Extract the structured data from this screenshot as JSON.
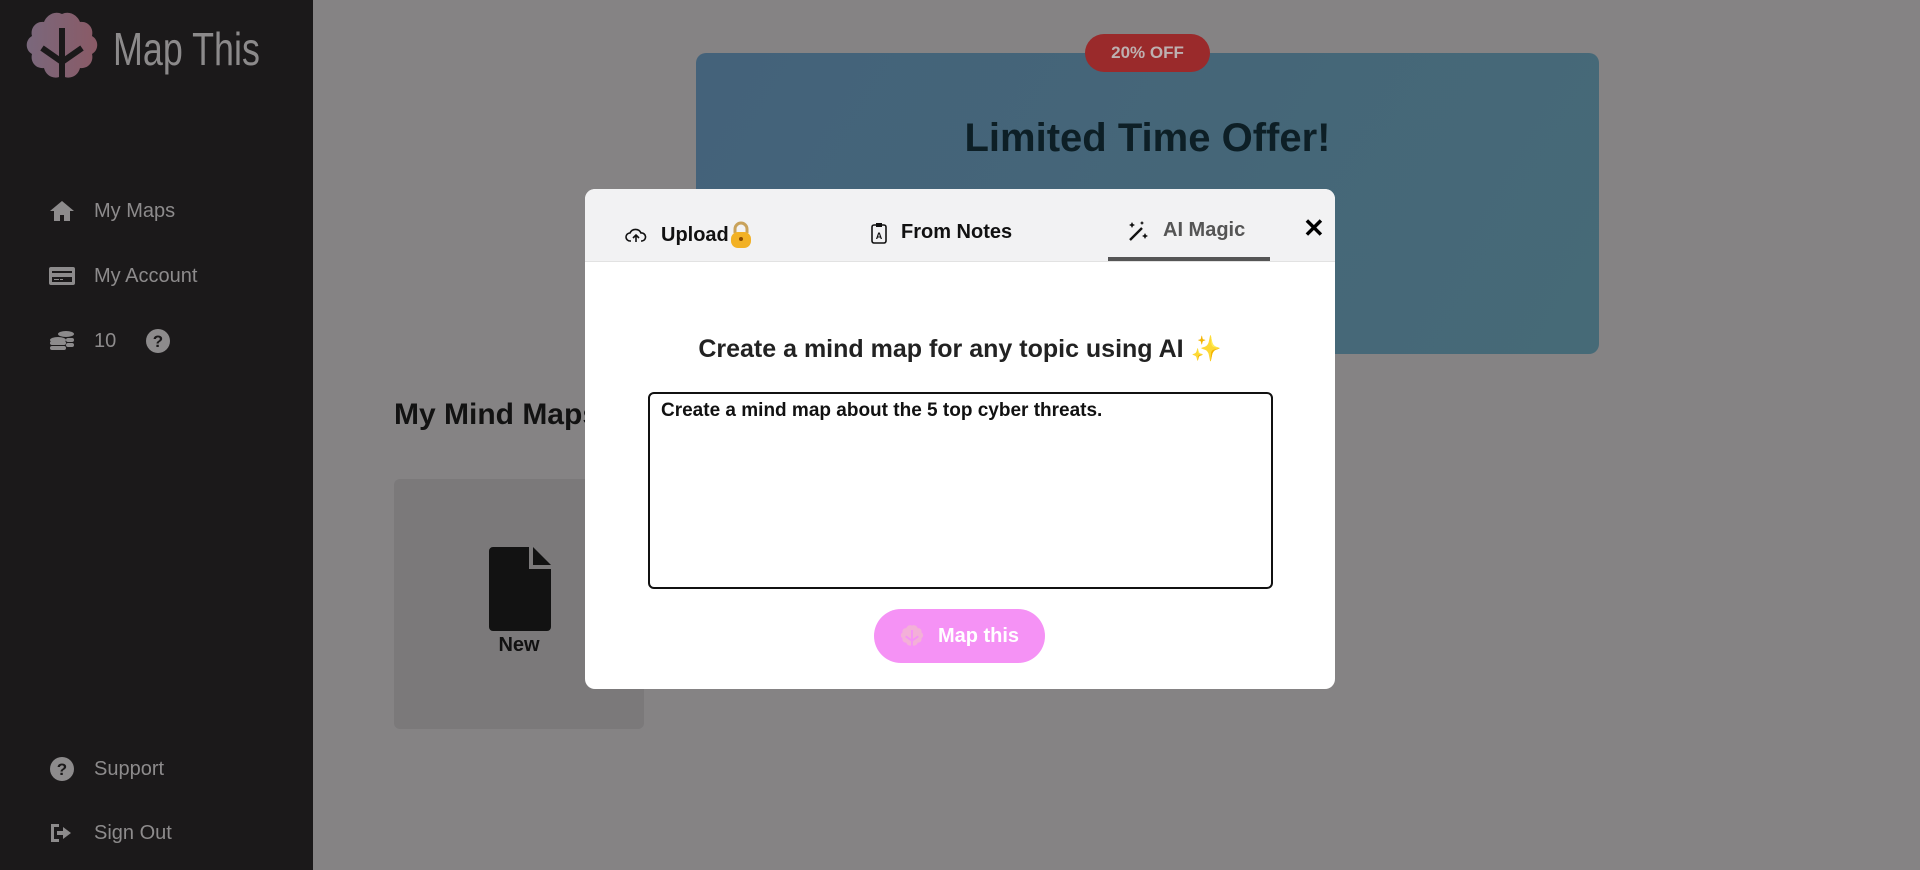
{
  "app": {
    "name": "Map This"
  },
  "sidebar": {
    "items": [
      {
        "label": "My Maps",
        "icon": "home-icon"
      },
      {
        "label": "My Account",
        "icon": "credit-card-icon"
      },
      {
        "label": "10",
        "icon": "coins-icon"
      }
    ],
    "bottom": [
      {
        "label": "Support",
        "icon": "question-circle-icon"
      },
      {
        "label": "Sign Out",
        "icon": "sign-out-icon"
      }
    ]
  },
  "banner": {
    "badge": "20% OFF",
    "title": "Limited Time Offer!"
  },
  "main": {
    "title": "My Mind Maps",
    "new_card": "New"
  },
  "modal": {
    "tabs": [
      {
        "label": "Upload",
        "locked": true
      },
      {
        "label": "From Notes"
      },
      {
        "label": "AI Magic",
        "active": true
      }
    ],
    "close": "✕",
    "heading": "Create a mind map for any topic using AI ✨",
    "input_value": "Create a mind map about the 5 top cyber threats.",
    "button": "Map this"
  },
  "colors": {
    "accent": "#f592f5",
    "badge": "#9a2a2b"
  }
}
